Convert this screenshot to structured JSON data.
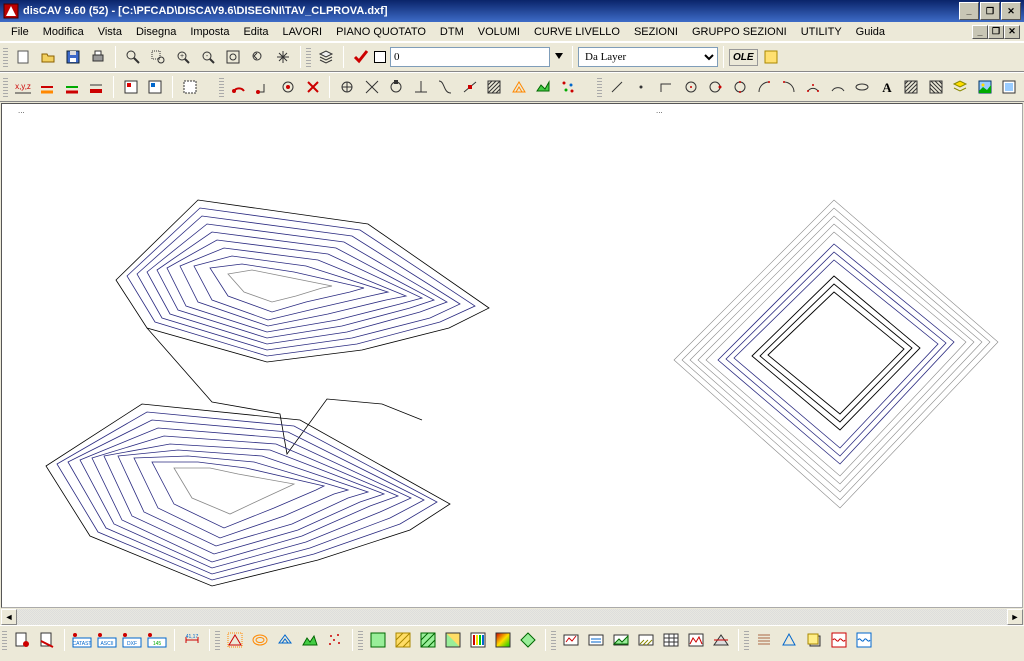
{
  "title": "disCAV 9.60 (52) - [C:\\PFCAD\\DISCAV9.6\\DISEGNI\\TAV_CLPROVA.dxf]",
  "menu": [
    "File",
    "Modifica",
    "Vista",
    "Disegna",
    "Imposta",
    "Edita",
    "LAVORI",
    "PIANO QUOTATO",
    "DTM",
    "VOLUMI",
    "CURVE LIVELLO",
    "SEZIONI",
    "GRUPPO SEZIONI",
    "UTILITY",
    "Guida"
  ],
  "layer_value": "0",
  "style_select": "Da Layer",
  "ole_label": "OLE",
  "tick_left": "...",
  "tick_right": "..."
}
